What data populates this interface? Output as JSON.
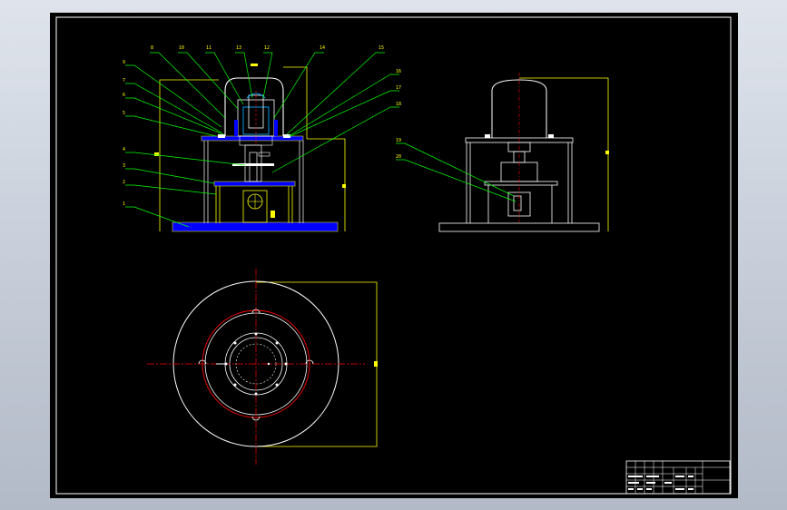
{
  "colors": {
    "background": "#000000",
    "frame": "#ffffff",
    "leader": "#00ff00",
    "part_outline": "#ffff00",
    "filled_part": "#0000ff",
    "centerline": "#ff0000",
    "hidden_line": "#ff0000",
    "title_block": "#ffffff"
  },
  "front_view": {
    "balloons": [
      {
        "num": "8",
        "side": "top"
      },
      {
        "num": "10",
        "side": "top"
      },
      {
        "num": "11",
        "side": "top"
      },
      {
        "num": "13",
        "side": "top"
      },
      {
        "num": "12",
        "side": "top"
      },
      {
        "num": "14",
        "side": "top"
      },
      {
        "num": "15",
        "side": "top"
      },
      {
        "num": "9",
        "side": "left"
      },
      {
        "num": "7",
        "side": "left"
      },
      {
        "num": "6",
        "side": "left"
      },
      {
        "num": "5",
        "side": "left"
      },
      {
        "num": "4",
        "side": "left"
      },
      {
        "num": "3",
        "side": "left"
      },
      {
        "num": "2",
        "side": "left"
      },
      {
        "num": "1",
        "side": "left"
      },
      {
        "num": "16",
        "side": "right"
      },
      {
        "num": "17",
        "side": "right"
      },
      {
        "num": "18",
        "side": "right"
      }
    ]
  },
  "side_view": {
    "balloons": [
      {
        "num": "19"
      },
      {
        "num": "20"
      }
    ]
  },
  "top_view": {},
  "title_block": {
    "rows": 5,
    "cols": 8
  }
}
